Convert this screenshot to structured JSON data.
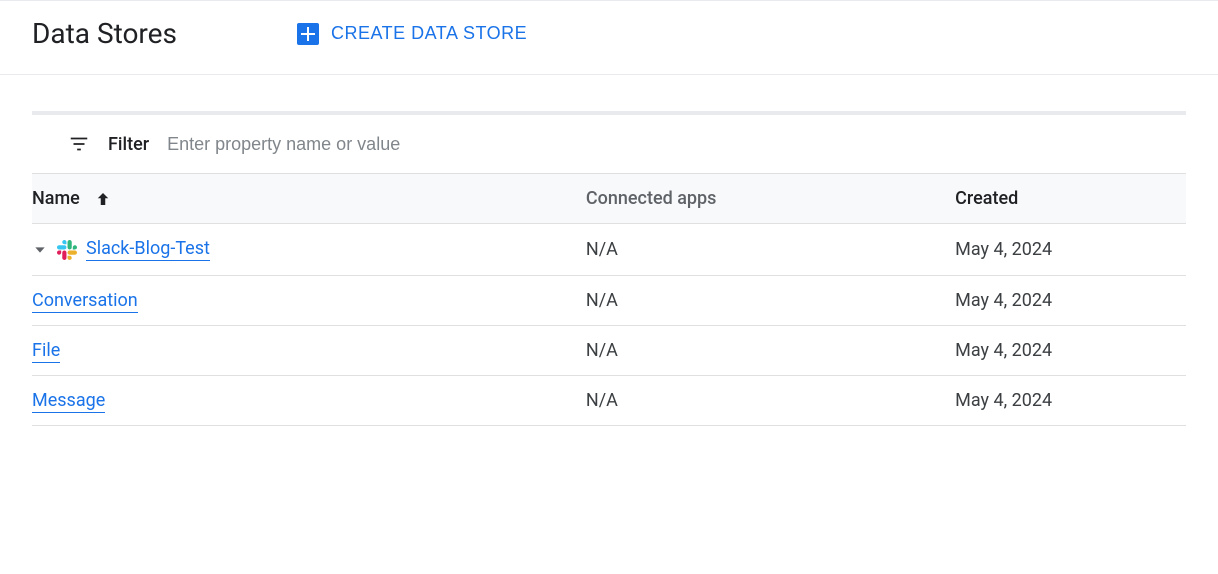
{
  "header": {
    "title": "Data Stores",
    "create_button_label": "CREATE DATA STORE"
  },
  "filter": {
    "label": "Filter",
    "placeholder": "Enter property name or value"
  },
  "table": {
    "columns": {
      "name": "Name",
      "connected_apps": "Connected apps",
      "created": "Created"
    },
    "rows": [
      {
        "name": "Slack-Blog-Test",
        "connected_apps": "N/A",
        "created": "May 4, 2024",
        "icon": "slack",
        "expanded": true,
        "children": [
          {
            "name": "Conversation",
            "connected_apps": "N/A",
            "created": "May 4, 2024"
          },
          {
            "name": "File",
            "connected_apps": "N/A",
            "created": "May 4, 2024"
          },
          {
            "name": "Message",
            "connected_apps": "N/A",
            "created": "May 4, 2024"
          }
        ]
      }
    ]
  }
}
